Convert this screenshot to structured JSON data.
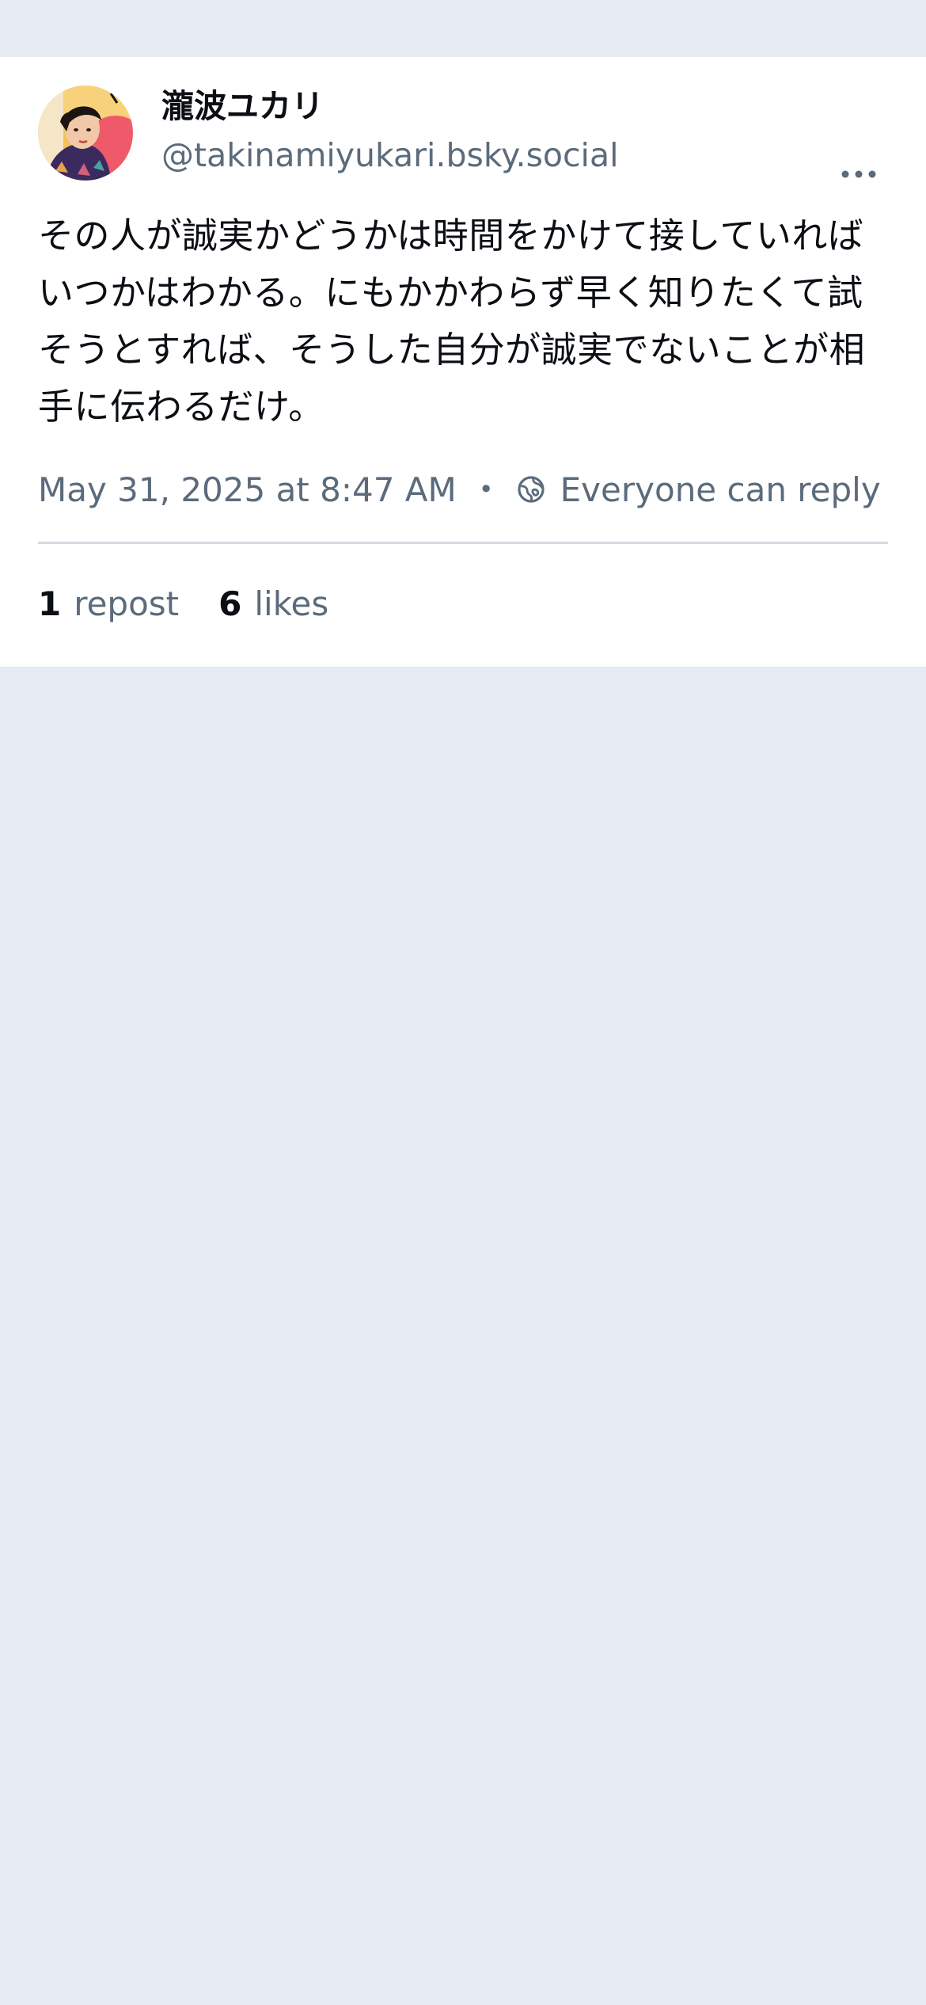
{
  "post": {
    "author": {
      "display_name": "瀧波ユカリ",
      "handle": "@takinamiyukari.bsky.social",
      "avatar_icon": "user-avatar"
    },
    "text": "その人が誠実かどうかは時間をかけて接していればいつかはわかる。にもかかわらず早く知りたくて試そうとすれば、そうした自分が誠実でないことが相手に伝わるだけ。",
    "timestamp": "May 31, 2025 at 8:47 AM",
    "separator": "•",
    "reply_setting": "Everyone can reply",
    "stats": {
      "reposts_count": "1",
      "reposts_label": "repost",
      "likes_count": "6",
      "likes_label": "likes"
    },
    "more_icon": "ellipsis-icon",
    "reply_icon": "globe-icon"
  },
  "colors": {
    "page_background": "#e6eaf2",
    "card_background": "#ffffff",
    "text_primary": "#0b0f14",
    "text_secondary": "#5b6b7c",
    "divider": "#d4dbe2"
  }
}
